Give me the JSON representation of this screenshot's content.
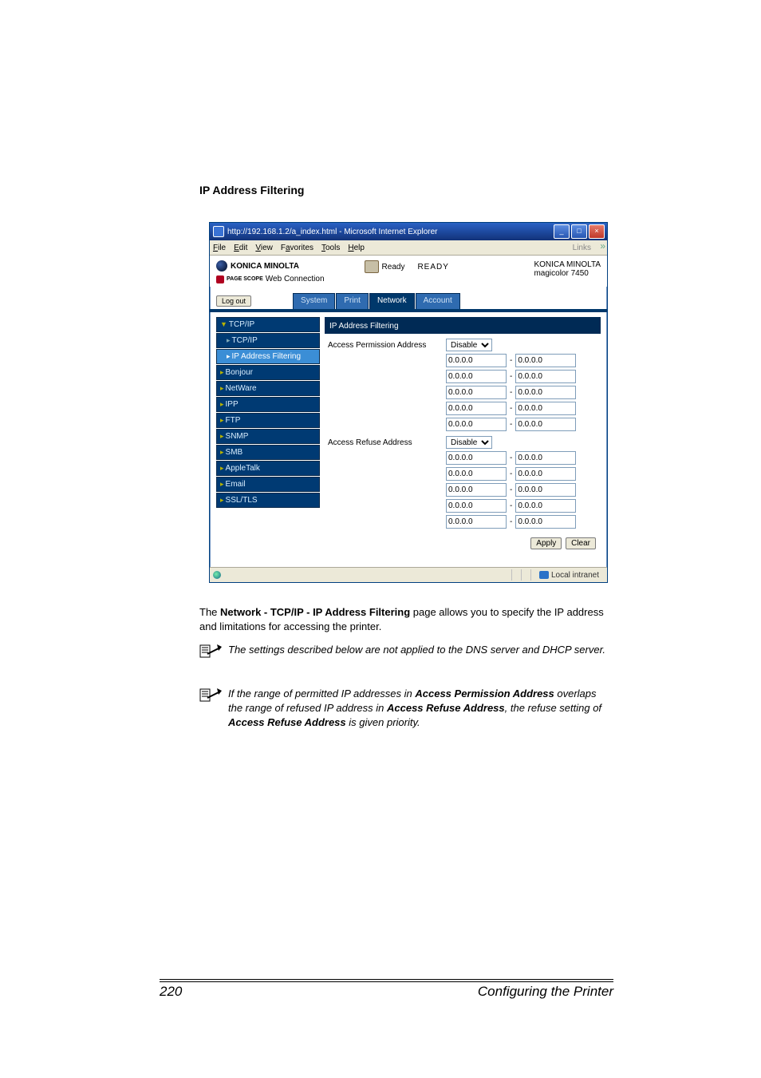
{
  "heading": "IP Address Filtering",
  "window": {
    "title": "http://192.168.1.2/a_index.html - Microsoft Internet Explorer",
    "links_label": "Links"
  },
  "menubar": {
    "items": [
      "File",
      "Edit",
      "View",
      "Favorites",
      "Tools",
      "Help"
    ]
  },
  "header": {
    "brand": "KONICA MINOLTA",
    "product": "Web Connection",
    "pagescope_prefix": "PAGE SCOPE",
    "status_label": "Ready",
    "ready": "READY",
    "model_brand": "KONICA MINOLTA",
    "model_name": "magicolor 7450"
  },
  "logout": "Log out",
  "tabs": [
    "System",
    "Print",
    "Network",
    "Account"
  ],
  "active_tab": 2,
  "sidebar": {
    "items": [
      {
        "label": "TCP/IP",
        "lvl": 0
      },
      {
        "label": "TCP/IP",
        "lvl": 1
      },
      {
        "label": "IP Address Filtering",
        "lvl": 1,
        "active": true
      },
      {
        "label": "Bonjour",
        "lvl": 0
      },
      {
        "label": "NetWare",
        "lvl": 0
      },
      {
        "label": "IPP",
        "lvl": 0
      },
      {
        "label": "FTP",
        "lvl": 0
      },
      {
        "label": "SNMP",
        "lvl": 0
      },
      {
        "label": "SMB",
        "lvl": 0
      },
      {
        "label": "AppleTalk",
        "lvl": 0
      },
      {
        "label": "Email",
        "lvl": 0
      },
      {
        "label": "SSL/TLS",
        "lvl": 0
      }
    ]
  },
  "panel": {
    "title": "IP Address Filtering",
    "perm_label": "Access Permission Address",
    "refuse_label": "Access Refuse Address",
    "perm_select": "Disable",
    "refuse_select": "Disable",
    "perm_rows": [
      {
        "from": "0.0.0.0",
        "to": "0.0.0.0"
      },
      {
        "from": "0.0.0.0",
        "to": "0.0.0.0"
      },
      {
        "from": "0.0.0.0",
        "to": "0.0.0.0"
      },
      {
        "from": "0.0.0.0",
        "to": "0.0.0.0"
      },
      {
        "from": "0.0.0.0",
        "to": "0.0.0.0"
      }
    ],
    "refuse_rows": [
      {
        "from": "0.0.0.0",
        "to": "0.0.0.0"
      },
      {
        "from": "0.0.0.0",
        "to": "0.0.0.0"
      },
      {
        "from": "0.0.0.0",
        "to": "0.0.0.0"
      },
      {
        "from": "0.0.0.0",
        "to": "0.0.0.0"
      },
      {
        "from": "0.0.0.0",
        "to": "0.0.0.0"
      }
    ],
    "apply": "Apply",
    "clear": "Clear"
  },
  "statusbar": {
    "zone": "Local intranet"
  },
  "body": {
    "para1_a": "The ",
    "para1_b": "Network - TCP/IP - IP Address Filtering",
    "para1_c": " page allows you to specify the IP address and limitations for accessing the printer.",
    "note1": "The settings described below are not applied to the DNS server and DHCP server.",
    "note2_a": "If the range of permitted IP addresses in ",
    "note2_b": "Access Permission Address",
    "note2_c": " overlaps the range of refused IP address in ",
    "note2_d": "Access Refuse Address",
    "note2_e": ", the refuse setting of ",
    "note2_f": "Access Refuse Address",
    "note2_g": " is given priority."
  },
  "footer": {
    "page": "220",
    "title": "Configuring the Printer"
  }
}
